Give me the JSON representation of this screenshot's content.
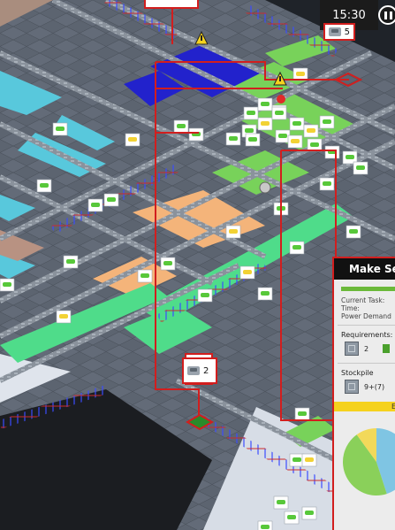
{
  "hud": {
    "clock": "15:30"
  },
  "labels": {
    "marker_count": "2",
    "topright_count": "5"
  },
  "info_panel": {
    "title": "Make Ser",
    "current_task_label": "Current Task:",
    "time_label": "Time:",
    "power_label": "Power Demand",
    "requirements_label": "Requirements:",
    "requirements_count": "2",
    "stockpile_label": "Stockpile",
    "stockpile_value": "9+(7)",
    "bar_label": "E"
  },
  "pie": {
    "slices": [
      {
        "color": "#7fc5e3",
        "fraction": 0.45
      },
      {
        "color": "#8ad05a",
        "fraction": 0.45
      },
      {
        "color": "#f2d95a",
        "fraction": 0.1
      }
    ]
  },
  "colors": {
    "selection": "#d21e1e",
    "crate_zone": "#58c8dc",
    "green_zone": "#78d25a",
    "orange_zone": "#f4b47a",
    "blue_zone": "#2222cc"
  }
}
